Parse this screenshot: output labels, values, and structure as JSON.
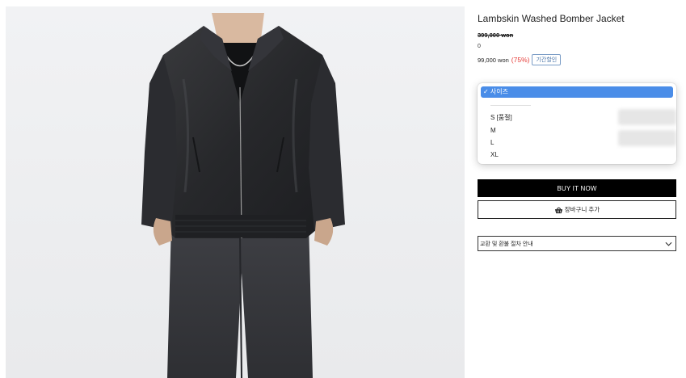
{
  "product": {
    "title": "Lambskin Washed Bomber Jacket",
    "original_price": "399,000 won",
    "zero_line": "0",
    "sale_price": "99,000 won",
    "discount": "(75%)",
    "badge": "기간할인"
  },
  "size_dropdown": {
    "selected": "✓ 사이즈",
    "separator": "-------------------------",
    "options": [
      "S [품절]",
      "M",
      "L",
      "XL"
    ]
  },
  "buttons": {
    "buy": "BUY IT NOW",
    "cart": "장바구니 추가"
  },
  "refund_info": {
    "label": "교환 및 환불 절차 안내"
  },
  "icons": {
    "cart": "basket-icon",
    "chevron": "chevron-down-icon"
  },
  "colors": {
    "accent_select": "#4a8de8",
    "discount_red": "#e53935",
    "badge_blue": "#4a74a8",
    "buy_button": "#000000"
  }
}
